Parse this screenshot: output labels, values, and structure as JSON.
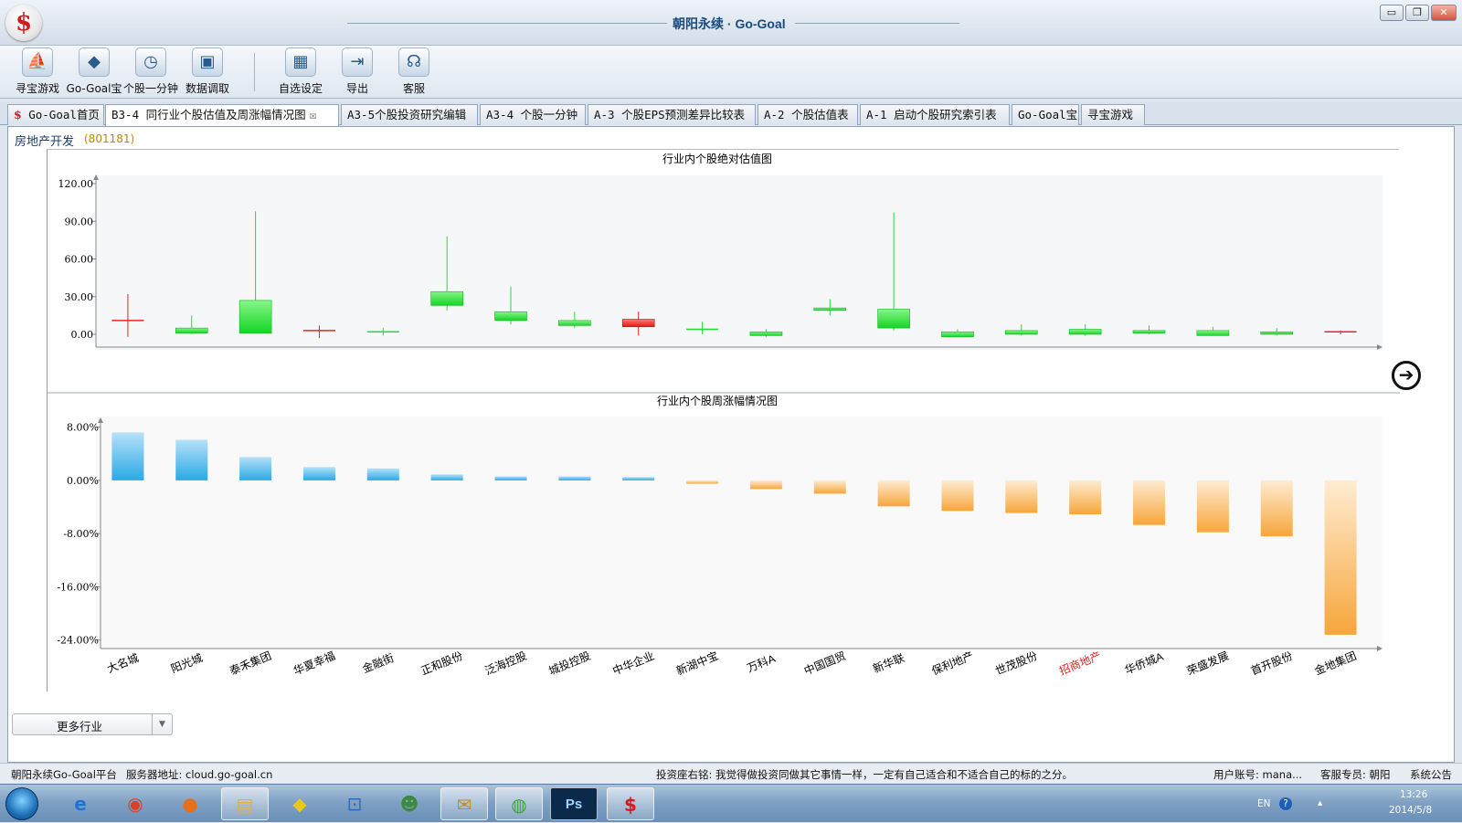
{
  "window": {
    "title": "朝阳永续 · Go-Goal",
    "logo": "$",
    "minimize": "▭",
    "restore": "❐",
    "close": "✕"
  },
  "toolbar": [
    {
      "label": "寻宝游戏",
      "icon": "treasure-icon",
      "glyph": "⛵"
    },
    {
      "label": "Go-Goal宝",
      "icon": "diamond-icon",
      "glyph": "◆"
    },
    {
      "label": "个股一分钟",
      "icon": "clock-search-icon",
      "glyph": "◷"
    },
    {
      "label": "数据调取",
      "icon": "camera-icon",
      "glyph": "▣"
    },
    {
      "label": "自选设定",
      "icon": "grid-icon",
      "glyph": "▦"
    },
    {
      "label": "导出",
      "icon": "export-icon",
      "glyph": "⇥"
    },
    {
      "label": "客服",
      "icon": "headset-icon",
      "glyph": "☊"
    }
  ],
  "tabs": [
    {
      "label": "Go-Goal首页",
      "logo": "$"
    },
    {
      "label": "B3-4 同行业个股估值及周涨幅情况图",
      "close": "☒",
      "active": true
    },
    {
      "label": "A3-5个股投资研究编辑"
    },
    {
      "label": "A3-4 个股一分钟"
    },
    {
      "label": "A-3 个股EPS预测差异比较表"
    },
    {
      "label": "A-2 个股估值表"
    },
    {
      "label": "A-1 启动个股研究索引表"
    },
    {
      "label": "Go-Goal宝"
    },
    {
      "label": "寻宝游戏"
    }
  ],
  "sector": {
    "name": "房地产开发",
    "code": "(801181)"
  },
  "next_arrow": "➔",
  "more_industry": {
    "label": "更多行业",
    "arrow": "▼"
  },
  "colors": {
    "up": "#22dd33",
    "down": "#ee2222",
    "gain_bar": "#2aa9e6",
    "loss_bar": "#f6a63b",
    "highlight_label": "#e02020"
  },
  "chart_data": [
    {
      "type": "candlestick",
      "title": "行业内个股绝对估值图",
      "ylim": [
        -8,
        120
      ],
      "yticks": [
        120,
        90,
        60,
        30,
        0
      ],
      "ytick_labels": [
        "120.00",
        "90.00",
        "60.00",
        "30.00",
        "0.00"
      ],
      "candles": [
        {
          "low": -2,
          "open": 11,
          "close": 10,
          "high": 32
        },
        {
          "low": 0,
          "open": 1,
          "close": 5,
          "high": 15
        },
        {
          "low": 1,
          "open": 1,
          "close": 27,
          "high": 98
        },
        {
          "low": -3,
          "open": 3,
          "close": 2,
          "high": 7
        },
        {
          "low": -1,
          "open": 1,
          "close": 2,
          "high": 5
        },
        {
          "low": 19,
          "open": 23,
          "close": 34,
          "high": 78
        },
        {
          "low": 8,
          "open": 11,
          "close": 18,
          "high": 38
        },
        {
          "low": 5,
          "open": 7,
          "close": 11,
          "high": 18
        },
        {
          "low": -1,
          "open": 12,
          "close": 6,
          "high": 18
        },
        {
          "low": 0,
          "open": 4,
          "close": 4,
          "high": 10
        },
        {
          "low": -2,
          "open": -1,
          "close": 2,
          "high": 4
        },
        {
          "low": 15,
          "open": 19,
          "close": 21,
          "high": 28
        },
        {
          "low": 3,
          "open": 5,
          "close": 20,
          "high": 97
        },
        {
          "low": -2,
          "open": -2,
          "close": 2,
          "high": 4
        },
        {
          "low": -1,
          "open": 0,
          "close": 3,
          "high": 8
        },
        {
          "low": -1,
          "open": 0,
          "close": 4,
          "high": 8
        },
        {
          "low": 0,
          "open": 1,
          "close": 3,
          "high": 7
        },
        {
          "low": -1,
          "open": -1,
          "close": 3,
          "high": 6
        },
        {
          "low": -1,
          "open": 0,
          "close": 2,
          "high": 5
        },
        {
          "low": 0,
          "open": 2,
          "close": 1,
          "high": 3
        }
      ]
    },
    {
      "type": "bar",
      "title": "行业内个股周涨幅情况图",
      "ylim": [
        -25,
        8.5
      ],
      "yticks": [
        8,
        0,
        -8,
        -16,
        -24
      ],
      "ytick_labels": [
        "8.00%",
        "0.00%",
        "-8.00%",
        "-16.00%",
        "-24.00%"
      ],
      "categories": [
        "大名城",
        "阳光城",
        "泰禾集团",
        "华夏幸福",
        "金融街",
        "正和股份",
        "泛海控股",
        "城投控股",
        "中华企业",
        "新湖中宝",
        "万科A",
        "中国国贸",
        "新华联",
        "保利地产",
        "世茂股份",
        "招商地产",
        "华侨城A",
        "荣盛发展",
        "首开股份",
        "金地集团"
      ],
      "values": [
        7.2,
        6.1,
        3.5,
        2.0,
        1.8,
        0.9,
        0.6,
        0.6,
        0.5,
        -0.5,
        -1.3,
        -2.0,
        -3.9,
        -4.6,
        -4.9,
        -5.1,
        -6.7,
        -7.8,
        -8.4,
        -23.2
      ],
      "highlight": "招商地产"
    }
  ],
  "status": {
    "platform": "朝阳永续Go-Goal平台",
    "server": "服务器地址: cloud.go-goal.cn",
    "motto": "投资座右铭: 我觉得做投资同做其它事情一样，一定有自己适合和不适合自己的标的之分。",
    "user": "用户账号: mana...",
    "service": "客服专员: 朝阳",
    "notice": "系统公告"
  },
  "taskbar": {
    "apps": [
      {
        "icon": "ie-icon",
        "glyph": "e"
      },
      {
        "icon": "chrome-icon",
        "glyph": "◉"
      },
      {
        "icon": "firefox-icon",
        "glyph": "●"
      },
      {
        "icon": "explorer-icon",
        "glyph": "▤"
      },
      {
        "icon": "ic-tester-icon",
        "glyph": "◆"
      },
      {
        "icon": "app-blue-icon",
        "glyph": "⊡"
      },
      {
        "icon": "people-icon",
        "glyph": "☻"
      },
      {
        "icon": "mail-icon",
        "glyph": "✉"
      },
      {
        "icon": "browser-green-icon",
        "glyph": "◍"
      },
      {
        "icon": "photoshop-icon",
        "glyph": "Ps"
      },
      {
        "icon": "gogoal-icon",
        "glyph": "$"
      }
    ],
    "lang": "EN",
    "help": "?",
    "tray_arrow": "▴",
    "time": "13:26",
    "date": "2014/5/8"
  }
}
